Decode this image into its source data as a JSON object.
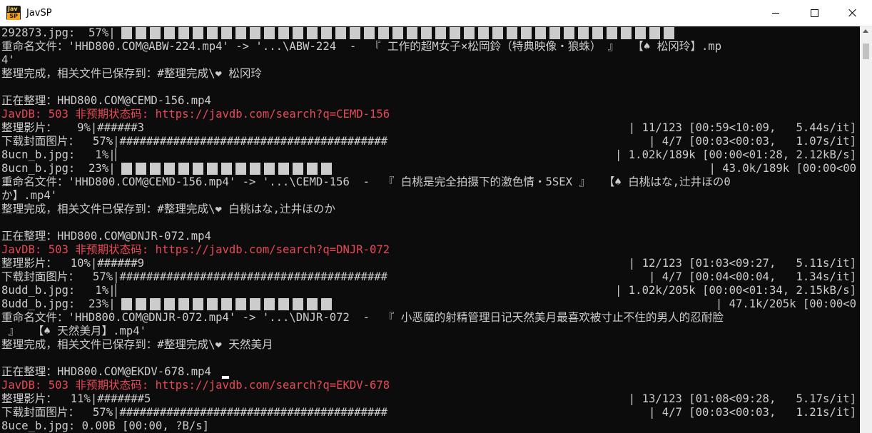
{
  "window": {
    "title": "JavSP",
    "icon": "javsp-app-icon"
  },
  "lines": [
    "292873.jpg:  57%|",
    "重命名文件：'HHD800.COM@ABW-224.mp4' -> '...\\ABW-224  -  『 工作的超M女子×松岡鈴（特典映像・狼蛛） 』  【♠ 松冈玲】.mp",
    "4'",
    "整理完成，相关文件已保存到：#整理完成\\❤ 松冈玲",
    "",
    "正在整理：HHD800.COM@CEMD-156.mp4",
    "JavDB: 503 非预期状态码: https://javdb.com/search?q=CEMD-156",
    "整理影片：   9%|######3",
    "下载封面图片：  57%|########################################",
    "8ucn_b.jpg:   1%|▏",
    "8ucn_b.jpg:  23%|",
    "重命名文件：'HHD800.COM@CEMD-156.mp4' -> '...\\CEMD-156  -  『 白桃是完全拍摄下的激色情・5SEX 』  【♠ 白桃はな,辻井ほの0",
    "か】.mp4'",
    "整理完成，相关文件已保存到：#整理完成\\❤ 白桃はな,辻井ほのか",
    "",
    "正在整理：HHD800.COM@DNJR-072.mp4",
    "JavDB: 503 非预期状态码: https://javdb.com/search?q=DNJR-072",
    "整理影片：  10%|######9",
    "下载封面图片：  57%|########################################",
    "8udd_b.jpg:   1%|▏",
    "8udd_b.jpg:  23%|",
    "重命名文件：'HHD800.COM@DNJR-072.mp4' -> '...\\DNJR-072  -  『 小恶魔的射精管理日记天然美月最喜欢被寸止不住的男人的忍耐脸",
    " 』  【♠ 天然美月】.mp4'",
    "整理完成，相关文件已保存到：#整理完成\\❤ 天然美月",
    "",
    "正在整理：HHD800.COM@EKDV-678.mp4",
    "JavDB: 503 非预期状态码: https://javdb.com/search?q=EKDV-678",
    "整理影片：  11%|#######5",
    "下载封面图片：  57%|########################################",
    "8uce_b.jpg: 0.00B [00:00, ?B/s]"
  ],
  "right_texts": [
    "| 11/123 [00:59<10:09,   5.44s/it]",
    "| 4/7 [00:03<00:03,   1.07s/it]",
    "| 1.02k/189k [00:00<01:28, 2.12kB/s]",
    "| 43.0k/189k [00:00<00",
    "| 12/123 [01:03<09:27,   5.11s/it]",
    "| 4/7 [00:04<00:04,   1.34s/it]",
    "| 1.02k/205k [00:00<01:34, 2.15kB/s]",
    "| 47.1k/205k [00:00<0",
    "| 13/123 [01:08<09:28,   5.17s/it]",
    "| 4/7 [00:03<00:03,   1.21s/it]"
  ]
}
